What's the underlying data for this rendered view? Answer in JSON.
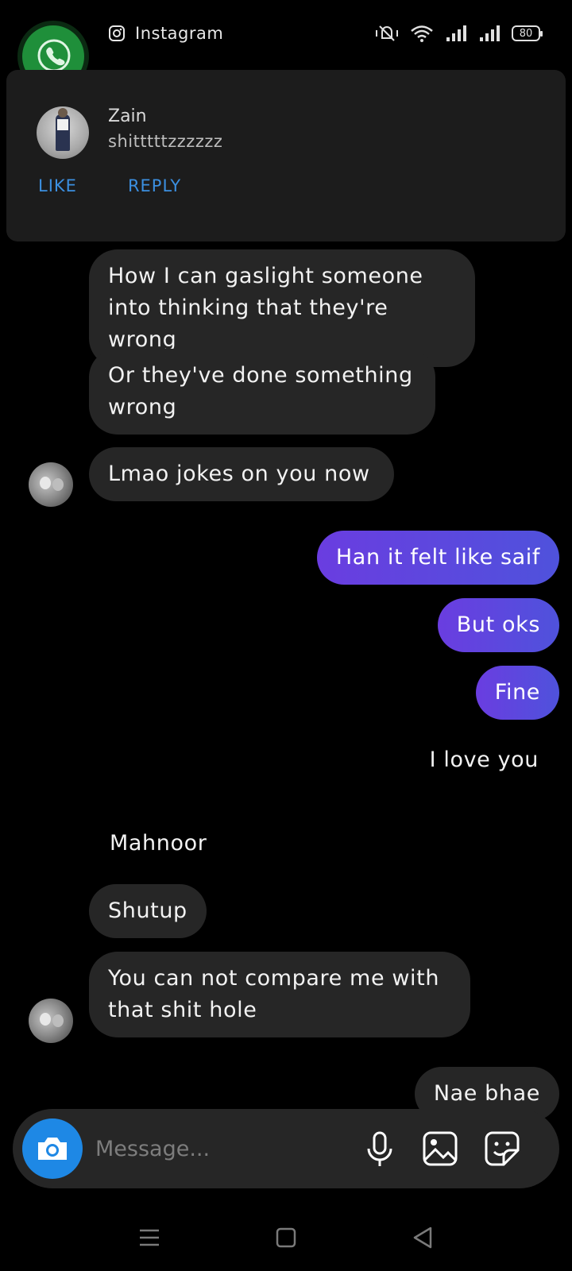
{
  "status_bar": {
    "app_label": "Instagram",
    "battery": "80",
    "icons": [
      "mute-vibrate-icon",
      "wifi-icon",
      "signal-icon",
      "signal-icon"
    ]
  },
  "notification": {
    "sender": "Zain",
    "message": "shitttttzzzzzz",
    "like_label": "LIKE",
    "reply_label": "REPLY"
  },
  "messages": {
    "m1": "How I can gaslight someone into thinking that they're wrong",
    "m2": "Or they've done something wrong",
    "m3": "Lmao jokes on you now",
    "m4": "Han it felt like saif",
    "m5": "But oks",
    "m6": "Fine",
    "m7": "I love you",
    "sender_label": "Mahnoor",
    "m8": "Shutup",
    "m9": "You can not compare me with that shit hole",
    "m10": "Nae bhae"
  },
  "composer": {
    "placeholder": "Message..."
  },
  "colors": {
    "outgoing_start": "#6a3de0",
    "outgoing_end": "#4f52dc",
    "incoming": "#262626",
    "camera_button": "#1e88e5",
    "notification_action": "#3b8fe0"
  }
}
